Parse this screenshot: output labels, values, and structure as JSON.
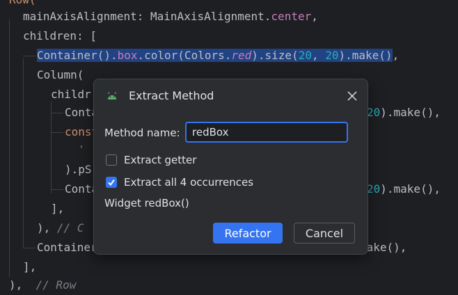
{
  "colors": {
    "accent": "#3574f0",
    "selection": "#214283",
    "editor_bg": "#1e1f22",
    "dialog_bg": "#2b2d30"
  },
  "code": {
    "l0": {
      "a": "Row("
    },
    "l1": {
      "a": "mainAxisAlignment: MainAxisAlignment.",
      "b": "center",
      "c": ","
    },
    "l2": {
      "a": "children: ["
    },
    "l3": {
      "a": "Container().",
      "b": "box",
      "c": ".color(Colors.",
      "d": "red",
      "e": ").size(",
      "f": "20",
      "g": ", ",
      "h": "20",
      "i": ").make()",
      "j": ","
    },
    "l4": {
      "a": "Column("
    },
    "l5": {
      "a": "childr"
    },
    "l6": {
      "a": "Conta",
      "b": "20",
      "c": ").make(),"
    },
    "l7": {
      "a": "const"
    },
    "l8": {
      "a": "'"
    },
    "l9": {
      "a": ").pS"
    },
    "l10": {
      "a": "Conta",
      "b": "20",
      "c": ").make(),"
    },
    "l11": {
      "a": "],"
    },
    "l12": {
      "a": "),",
      "b": "// C"
    },
    "l13": {
      "a": "Container",
      "b": "make(),"
    },
    "l14": {
      "a": "],"
    },
    "l15": {
      "a": "),",
      "b": "// Row"
    }
  },
  "dialog": {
    "title": "Extract Method",
    "icon": "android-icon",
    "close_icon": "close-icon",
    "method_name_label": "Method name:",
    "method_name_value": "redBox",
    "extract_getter_label": "Extract getter",
    "extract_getter_checked": false,
    "extract_all_label": "Extract all 4 occurrences",
    "extract_all_checked": true,
    "signature": "Widget redBox()",
    "refactor_label": "Refactor",
    "cancel_label": "Cancel"
  }
}
